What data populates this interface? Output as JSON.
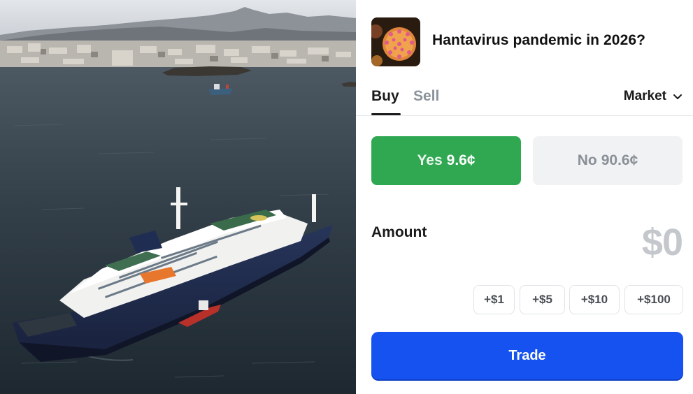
{
  "photo": {
    "description_icon": "cruise-ship-photo"
  },
  "market": {
    "title": "Hantavirus pandemic in 2026?",
    "icon": "virus-icon"
  },
  "tabs": {
    "buy_label": "Buy",
    "sell_label": "Sell",
    "active": "Buy"
  },
  "order_type": {
    "label": "Market",
    "icon": "chevron-down-icon"
  },
  "outcomes": {
    "yes_label": "Yes",
    "yes_price": "9.6¢",
    "no_label": "No",
    "no_price": "90.6¢",
    "selected": "Yes"
  },
  "amount": {
    "label": "Amount",
    "value": "$0"
  },
  "quick_amounts": [
    "+$1",
    "+$5",
    "+$10",
    "+$100"
  ],
  "trade_button": {
    "label": "Trade"
  },
  "colors": {
    "yes_green": "#30a852",
    "no_gray": "#f1f2f3",
    "trade_blue": "#1652f0",
    "sell_gray": "#8b939c",
    "amount_gray": "#c4c8cc"
  }
}
